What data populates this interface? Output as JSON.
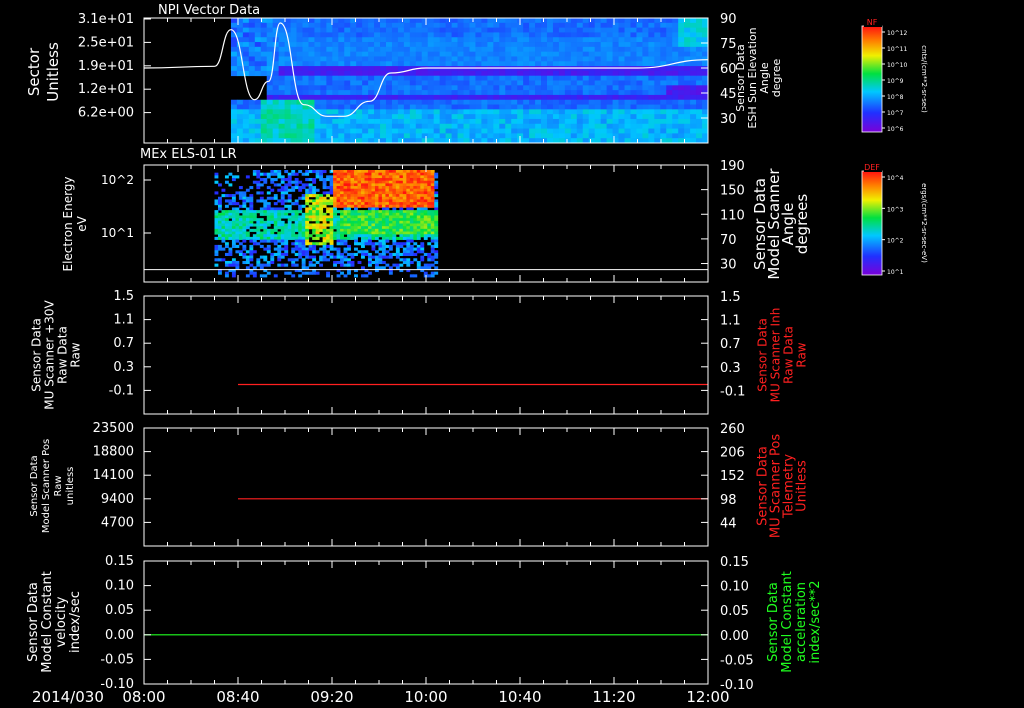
{
  "colors": {
    "background": "#000000",
    "axis": "#ffffff",
    "red_trace": "#ff2020",
    "green_trace": "#20ff20",
    "white_trace": "#ffffff"
  },
  "time_axis": {
    "date_label": "2014/030",
    "ticks": [
      "08:00",
      "08:40",
      "09:20",
      "10:00",
      "10:40",
      "11:20",
      "12:00"
    ],
    "range": [
      "08:00",
      "12:00"
    ]
  },
  "colorbars": [
    {
      "label": "NF",
      "units": "cnts/(cm**2-sr-sec)",
      "ticks": [
        "10^12",
        "10^11",
        "10^10",
        "10^9",
        "10^8",
        "10^7",
        "10^6"
      ]
    },
    {
      "label": "DEF",
      "units": "ergs/(cm**2-sr-sec-eV)",
      "ticks": [
        "10^4",
        "10^3",
        "10^2",
        "10^1"
      ]
    }
  ],
  "chart_data": [
    {
      "type": "heatmap",
      "title": "NPI Vector Data",
      "ylabel": [
        "Sector",
        "Unitless"
      ],
      "y_ticks": [
        "3.1e+01",
        "2.5e+01",
        "1.9e+01",
        "1.2e+01",
        "6.2e+00"
      ],
      "ylim": [
        0,
        31
      ],
      "data_start": "08:37",
      "data_end": "12:00",
      "right_axis": {
        "label": [
          "Sensor Data",
          "ESH Sun Elevation",
          "Angle",
          "degree"
        ],
        "ticks": [
          "90",
          "75",
          "60",
          "45",
          "30"
        ],
        "ylim": [
          15,
          90
        ],
        "color": "#ffffff"
      },
      "overlay_line": {
        "name": "ESH Sun Elevation Angle",
        "x": [
          "08:00",
          "08:30",
          "08:37",
          "08:47",
          "08:53",
          "08:58",
          "09:08",
          "09:18",
          "09:25",
          "09:36",
          "09:45",
          "10:00",
          "11:30",
          "12:00"
        ],
        "y": [
          60,
          61,
          83,
          41,
          52,
          87,
          38,
          31,
          31,
          40,
          57,
          60,
          60,
          65
        ]
      }
    },
    {
      "type": "heatmap",
      "title": "MEx ELS-01 LR",
      "ylabel": [
        "Electron Energy",
        "eV"
      ],
      "y_ticks": [
        "10^2",
        "10^1"
      ],
      "y_log": true,
      "data_start": "08:30",
      "data_end": "10:05",
      "right_axis": {
        "label": [
          "Sensor Data",
          "Model Scanner",
          "Angle",
          "degrees"
        ],
        "ticks": [
          "190",
          "150",
          "110",
          "70",
          "30"
        ],
        "ylim": [
          0,
          190
        ],
        "color": "#ffffff"
      },
      "overlay_line": {
        "name": "Model Scanner Angle",
        "x": [
          "08:00",
          "12:00"
        ],
        "y": [
          20,
          20
        ]
      }
    },
    {
      "type": "line",
      "ylabel": [
        "Sensor Data",
        "MU Scanner +30V",
        "Raw Data",
        "Raw"
      ],
      "y_ticks": [
        "1.5",
        "1.1",
        "0.7",
        "0.3",
        "-0.1"
      ],
      "ylim": [
        -0.5,
        1.5
      ],
      "right_axis": {
        "label": [
          "Sensor Data",
          "MU Scanner Inh",
          "Raw Data",
          "Raw"
        ],
        "ticks": [
          "1.5",
          "1.1",
          "0.7",
          "0.3",
          "-0.1"
        ],
        "ylim": [
          -0.5,
          1.5
        ],
        "color": "#ff2020"
      },
      "series": [
        {
          "x": [
            "08:40",
            "12:00"
          ],
          "y": [
            0.0,
            0.0
          ],
          "color": "#ff2020"
        }
      ]
    },
    {
      "type": "line",
      "ylabel": [
        "Sensor Data",
        "Model Scanner Pos",
        "Raw",
        "unitless"
      ],
      "y_ticks": [
        "23500",
        "18800",
        "14100",
        "9400",
        "4700"
      ],
      "ylim": [
        0,
        23500
      ],
      "right_axis": {
        "label": [
          "Sensor Data",
          "MU Scanner Pos",
          "Telemetry",
          "Unitless"
        ],
        "ticks": [
          "260",
          "206",
          "152",
          "98",
          "44"
        ],
        "ylim": [
          -10,
          260
        ],
        "color": "#ff2020"
      },
      "series": [
        {
          "x": [
            "08:40",
            "12:00"
          ],
          "y": [
            9400,
            9400
          ],
          "color": "#ff2020"
        }
      ]
    },
    {
      "type": "line",
      "ylabel": [
        "Sensor Data",
        "Model Constant",
        "velocity",
        "index/sec"
      ],
      "y_ticks": [
        "0.15",
        "0.10",
        "0.05",
        "0.00",
        "-0.05",
        "-0.10"
      ],
      "ylim": [
        -0.1,
        0.15
      ],
      "right_axis": {
        "label": [
          "Sensor Data",
          "Model Constant",
          "acceleration",
          "index/sec**2"
        ],
        "ticks": [
          "0.15",
          "0.10",
          "0.05",
          "0.00",
          "-0.05",
          "-0.10"
        ],
        "ylim": [
          -0.1,
          0.15
        ],
        "color": "#20ff20"
      },
      "series": [
        {
          "x": [
            "08:00",
            "12:00"
          ],
          "y": [
            0.0,
            0.0
          ],
          "color": "#20ff20"
        }
      ]
    }
  ]
}
